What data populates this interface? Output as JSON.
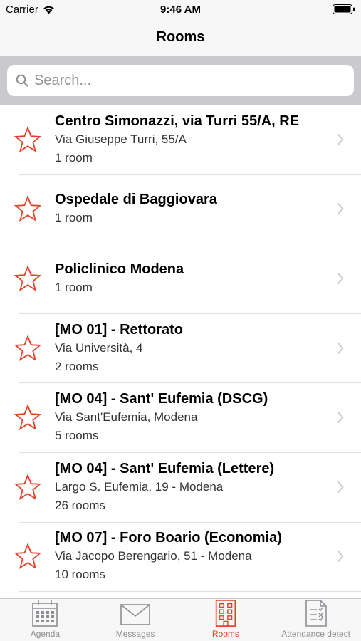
{
  "status_bar": {
    "carrier": "Carrier",
    "time": "9:46 AM"
  },
  "nav": {
    "title": "Rooms"
  },
  "search": {
    "placeholder": "Search..."
  },
  "colors": {
    "accent": "#e2412a",
    "inactive": "#8e8e93"
  },
  "rooms": [
    {
      "title": "Centro Simonazzi, via Turri 55/A, RE",
      "address": "Via Giuseppe Turri, 55/A",
      "count": "1 room"
    },
    {
      "title": "Ospedale di Baggiovara",
      "address": "",
      "count": "1 room"
    },
    {
      "title": "Policlinico Modena",
      "address": "",
      "count": "1 room"
    },
    {
      "title": "[MO 01]  - Rettorato",
      "address": "Via Università, 4",
      "count": "2 rooms"
    },
    {
      "title": "[MO 04] - Sant' Eufemia (DSCG)",
      "address": "Via Sant'Eufemia, Modena",
      "count": "5 rooms"
    },
    {
      "title": "[MO 04] - Sant' Eufemia (Lettere)",
      "address": "Largo S. Eufemia, 19 - Modena",
      "count": "26 rooms"
    },
    {
      "title": "[MO 07]  - Foro Boario (Economia)",
      "address": "Via Jacopo Berengario, 51 - Modena",
      "count": "10 rooms"
    }
  ],
  "tabs": [
    {
      "label": "Agenda",
      "icon": "calendar-icon",
      "active": false
    },
    {
      "label": "Messages",
      "icon": "envelope-icon",
      "active": false
    },
    {
      "label": "Rooms",
      "icon": "building-icon",
      "active": true
    },
    {
      "label": "Attendance detect",
      "icon": "checklist-icon",
      "active": false
    }
  ]
}
